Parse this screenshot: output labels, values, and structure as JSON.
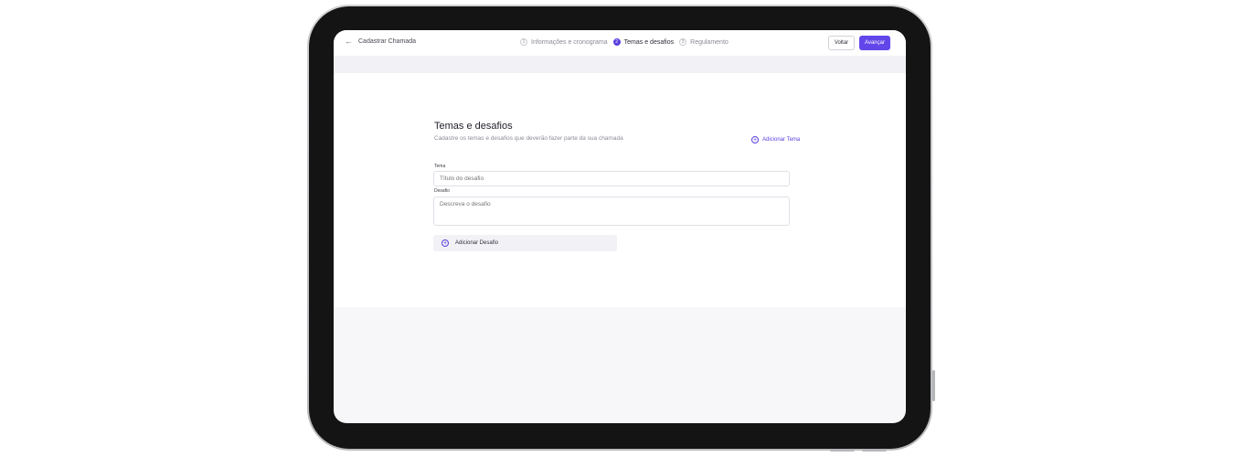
{
  "header": {
    "back_label": "Cadastrar Chamada",
    "steps": [
      {
        "number": "1",
        "label": "Informações e cronograma",
        "active": false
      },
      {
        "number": "2",
        "label": "Temas e desafios",
        "active": true
      },
      {
        "number": "3",
        "label": "Regulamento",
        "active": false
      }
    ],
    "voltar_label": "Voltar",
    "avancar_label": "Avançar"
  },
  "form": {
    "title": "Temas e desafios",
    "subtitle": "Cadastre os temas e desafios que deverão fazer parte da sua chamada",
    "add_tema_label": "Adicionar Tema",
    "tema_label": "Tema",
    "tema_placeholder": "Título do desafio",
    "desafio_label": "Desafio",
    "desafio_placeholder": "Descreva o desafio",
    "add_desafio_label": "Adicionar Desafio"
  },
  "icons": {
    "back": "arrow-left-icon",
    "add_tema": "plus-circle-icon",
    "add_desafio": "plus-circle-icon"
  },
  "colors": {
    "accent": "#6246ea",
    "page_bg": "#f7f7fa",
    "device_frame": "#141414"
  }
}
